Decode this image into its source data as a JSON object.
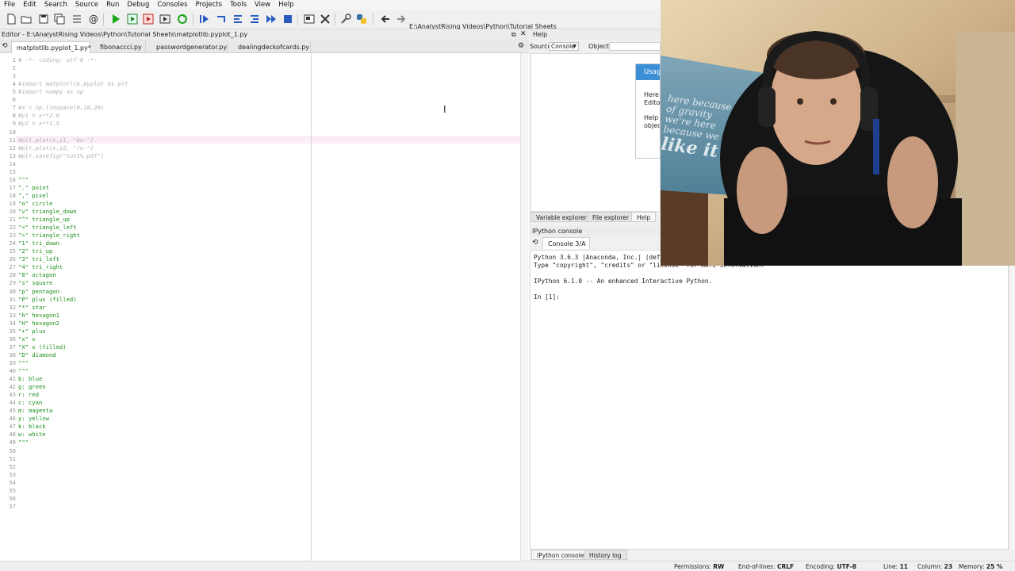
{
  "menu": [
    "File",
    "Edit",
    "Search",
    "Source",
    "Run",
    "Debug",
    "Consoles",
    "Projects",
    "Tools",
    "View",
    "Help"
  ],
  "toolbar": {
    "path": "E:\\AnalystRising Videos\\Python\\Tutorial Sheets"
  },
  "editor": {
    "title": "Editor - E:\\AnalystRising Videos\\Python\\Tutorial Sheets\\matplotlib.pyplot_1.py",
    "tabs": [
      "matplotlib.pyplot_1.py*",
      "fibonaccci.py",
      "passwordgenerator.py",
      "dealingdeckofcards.py"
    ],
    "lines": [
      "# -*- coding: utf-8 -*-",
      "",
      "",
      "#import matplotlib.pyplot as plt",
      "#import numpy as np",
      "",
      "#x = np.linspace(0,10,20)",
      "#y1 = x**2.0",
      "#y2 = x**1.5",
      "",
      "#plt.plot(x,y1, \"bo-\")",
      "#plt.plot(x,y2, \"ro-\")",
      "#plt.savefig(\"tut1%.pdf\")",
      "",
      "",
      "\"\"\"",
      "\".\" point",
      "\",\" pixel",
      "\"o\" circle",
      "\"v\" triangle_down",
      "\"^\" triangle_up",
      "\"<\" triangle_left",
      "\">\" triangle_right",
      "\"1\" tri_down",
      "\"2\" tri_up",
      "\"3\" tri_left",
      "\"4\" tri_right",
      "\"8\" octagon",
      "\"s\" square",
      "\"p\" pentagon",
      "\"P\" plus (filled)",
      "\"*\" star",
      "\"h\" hexagon1",
      "\"H\" hexagon2",
      "\"+\" plus",
      "\"x\" x",
      "\"X\" x (filled)",
      "\"D\" diamond",
      "\"\"\"",
      "\"\"\"",
      "b: blue",
      "g: green",
      "r: red",
      "c: cyan",
      "m: magenta",
      "y: yellow",
      "k: black",
      "w: white",
      "\"\"\"",
      "",
      "",
      "",
      "",
      "",
      "",
      "",
      ""
    ]
  },
  "help": {
    "title": "Help",
    "source_label": "Source",
    "source_value": "Console",
    "object_label": "Object",
    "usage_head": "Usage",
    "usage_l1": "Here",
    "usage_l2": "Editor",
    "usage_l3": "Help",
    "usage_l4": "object",
    "tabs": [
      "Variable explorer",
      "File explorer",
      "Help"
    ]
  },
  "console": {
    "title": "IPython console",
    "tab": "Console 3/A",
    "lines": [
      "Python 3.6.3 |Anaconda, Inc.| (default, ",
      "Type \"copyright\", \"credits\" or \"license\" for more information.",
      "",
      "IPython 6.1.0 -- An enhanced Interactive Python.",
      "",
      "In [1]:"
    ],
    "bottom_tabs": [
      "IPython console",
      "History log"
    ]
  },
  "status": {
    "permissions_label": "Permissions:",
    "permissions": "RW",
    "eol_label": "End-of-lines:",
    "eol": "CRLF",
    "encoding_label": "Encoding:",
    "encoding": "UTF-8",
    "line_label": "Line:",
    "line": "11",
    "column_label": "Column:",
    "column": "23",
    "memory_label": "Memory:",
    "memory": "25 %"
  },
  "webcam": {
    "poster_text": [
      "here because",
      "of gravity",
      "we're here",
      "because we",
      "like it"
    ]
  }
}
